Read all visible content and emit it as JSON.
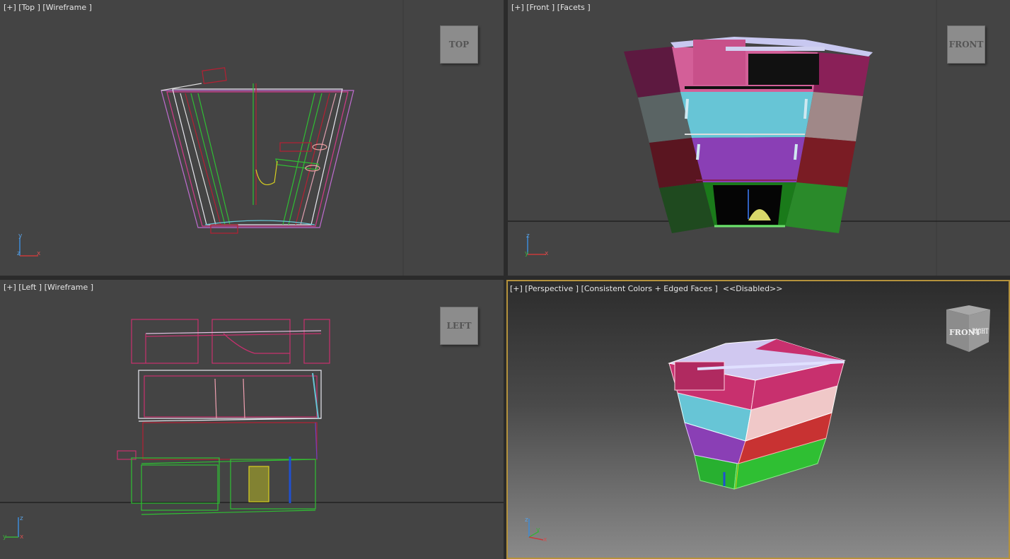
{
  "viewports": {
    "top": {
      "label": "[+] [Top ] [Wireframe ]",
      "nav_label": "TOP"
    },
    "front": {
      "label": "[+] [Front ] [Facets ]",
      "nav_label": "FRONT"
    },
    "left": {
      "label": "[+] [Left ] [Wireframe ]",
      "nav_label": "LEFT"
    },
    "perspective": {
      "label": "[+] [Perspective ] [Consistent Colors + Edged Faces ]  <<Disabled>>",
      "nav_front": "FRONT",
      "nav_right": "RIGHT"
    }
  },
  "axes": {
    "top": {
      "a": "y",
      "b": "z",
      "c": "x"
    },
    "front": {
      "a": "z",
      "b": "y",
      "c": "x"
    },
    "left": {
      "a": "z",
      "b": "y",
      "c": "x"
    },
    "perspective": {
      "a": "z",
      "b": "y",
      "c": "x"
    }
  },
  "colors": {
    "viewport_bg": "#444444",
    "active_border": "#b4923c",
    "magenta": "#c8306e",
    "pink": "#d35f98",
    "cyan": "#67c5d6",
    "purple": "#8a3fb5",
    "red": "#8c1e2a",
    "green": "#2fbf33"
  }
}
